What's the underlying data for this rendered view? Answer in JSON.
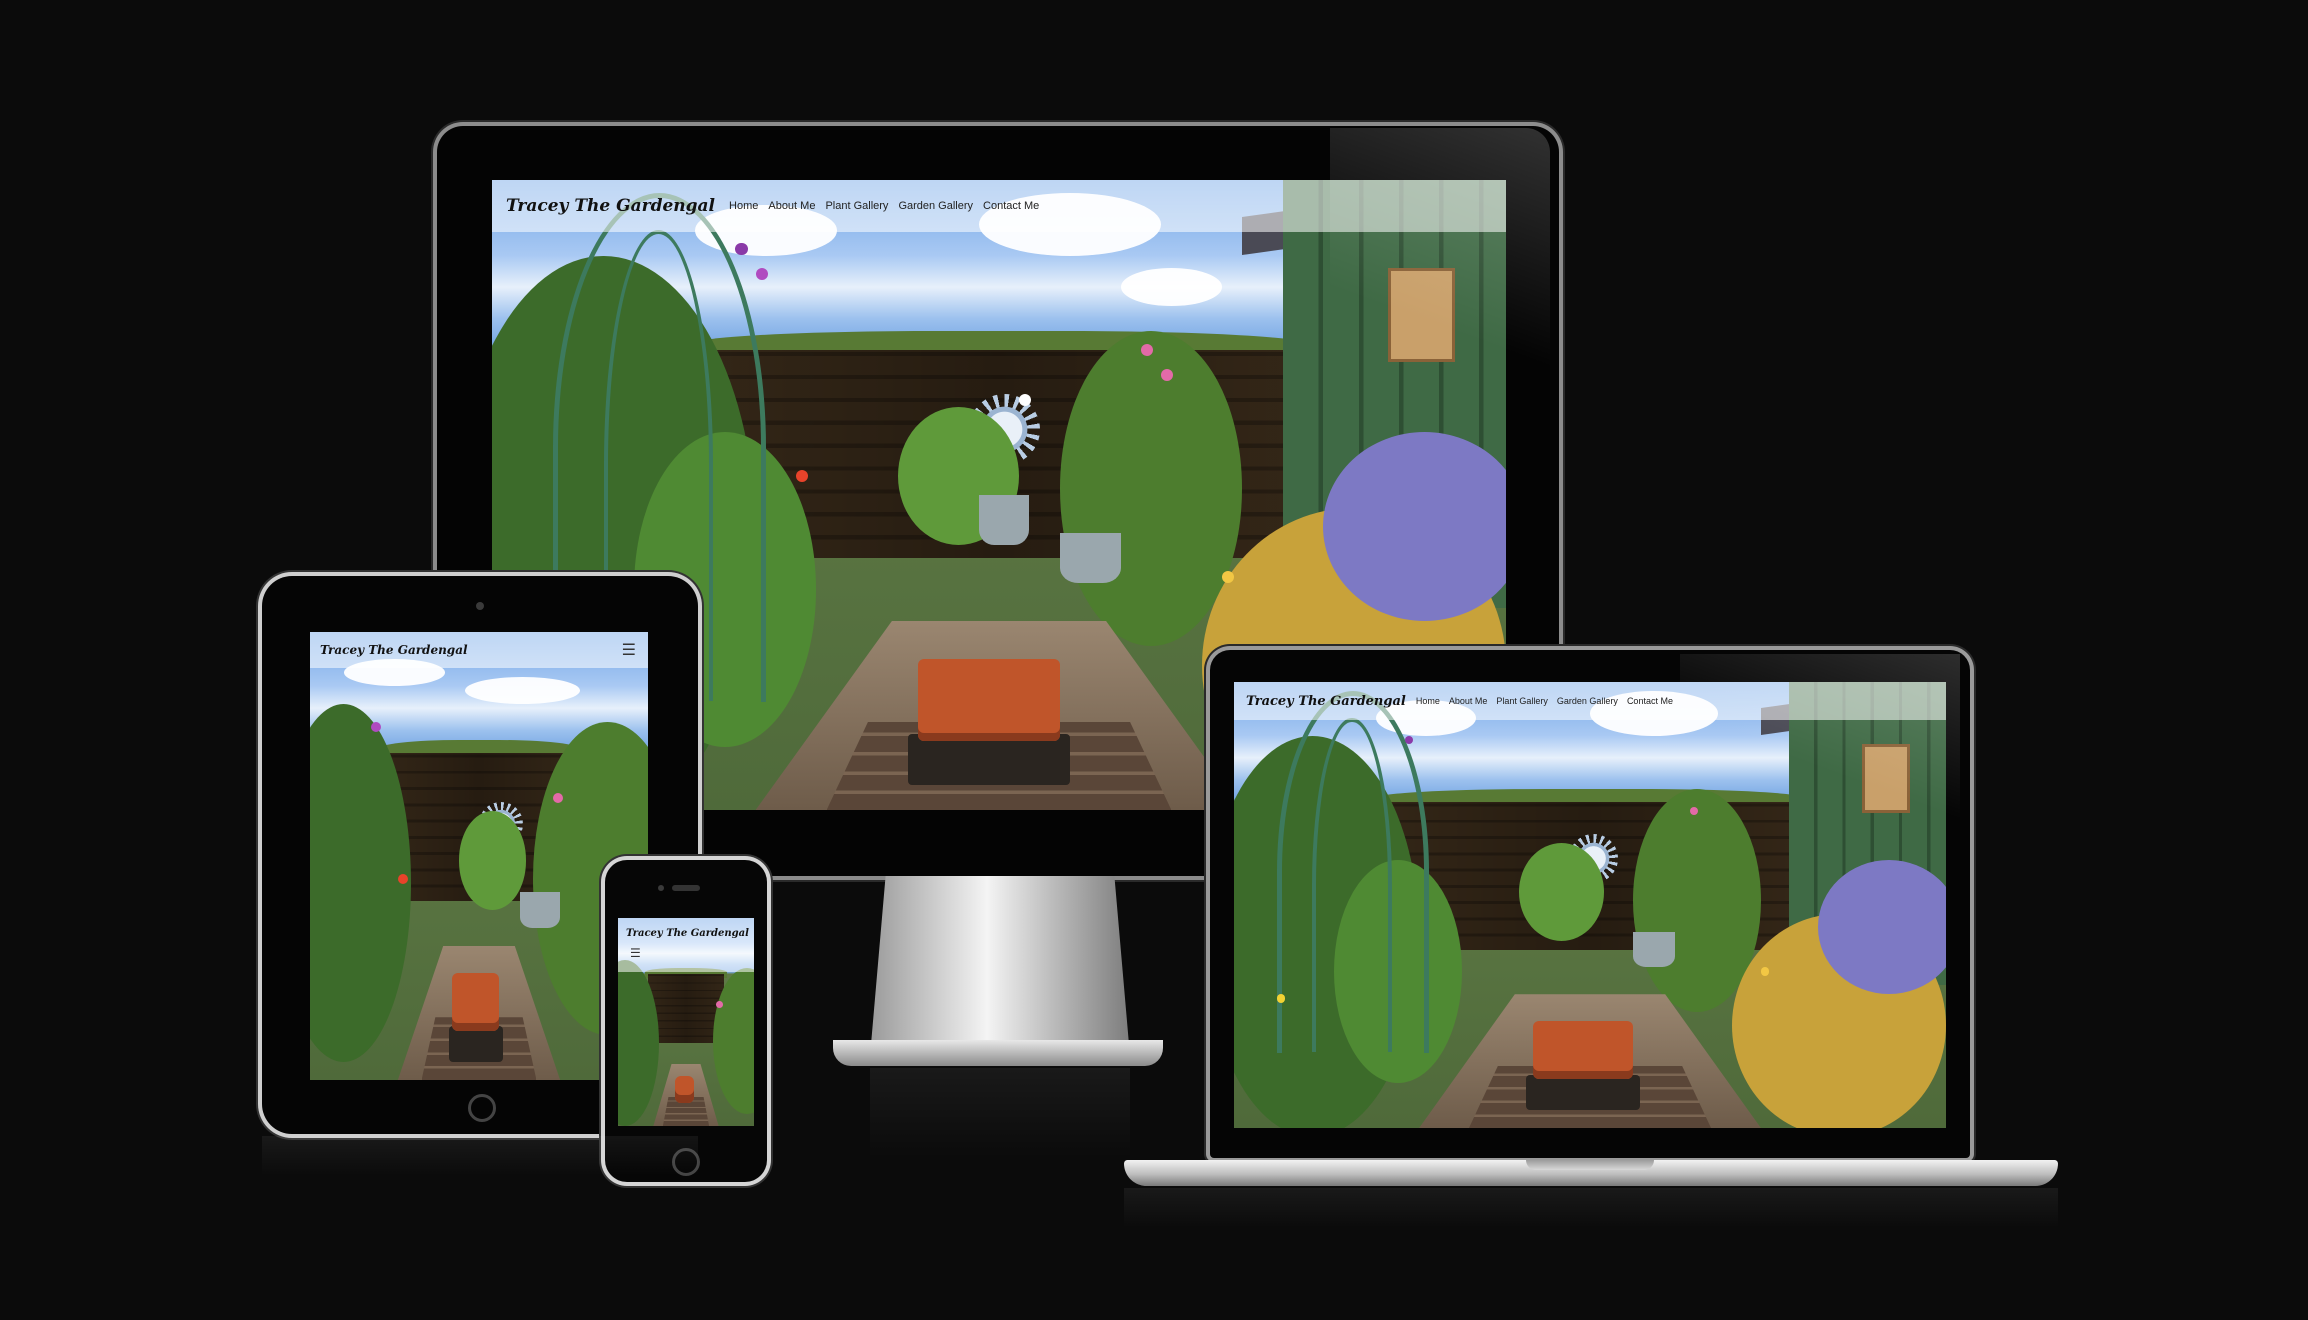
{
  "site": {
    "logo": "Tracey The Gardengal",
    "nav_items": [
      "Home",
      "About Me",
      "Plant Gallery",
      "Garden Gallery",
      "Contact Me"
    ],
    "menu_icon": "hamburger-icon"
  },
  "devices": [
    "desktop-monitor",
    "tablet",
    "smartphone",
    "laptop"
  ],
  "colors": {
    "background": "#0b0b0b",
    "nav_overlay": "#ffffff",
    "shed_green": "#3f6a45",
    "trough_terracotta": "#c0552a"
  }
}
